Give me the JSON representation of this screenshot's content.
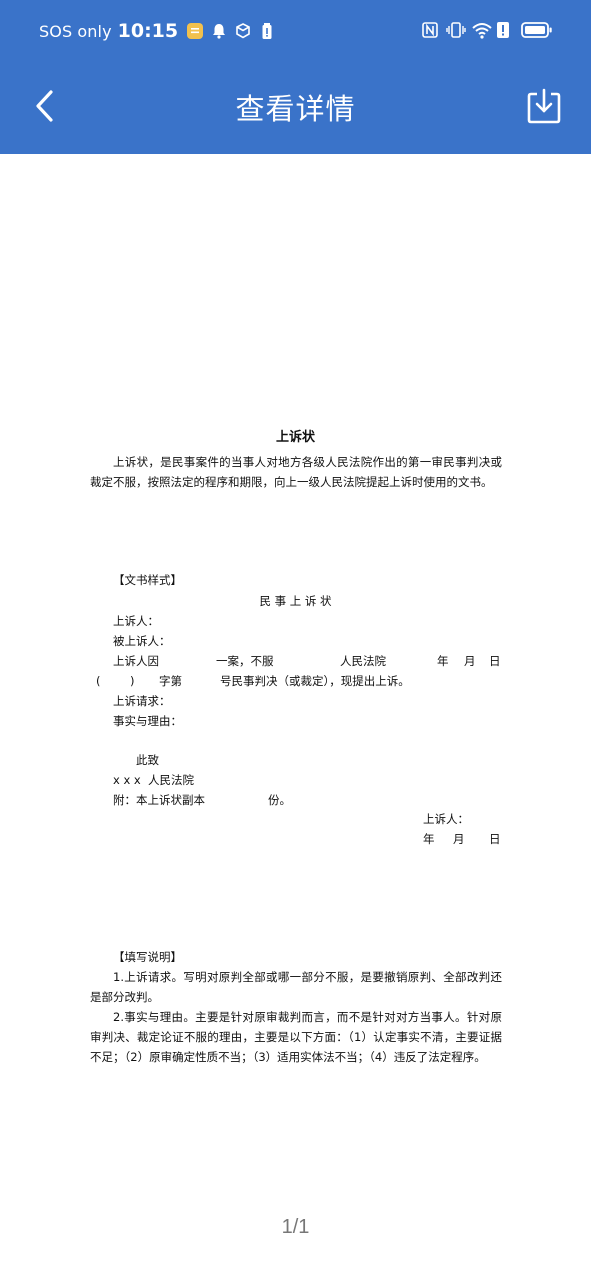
{
  "status_bar": {
    "carrier": "SOS only",
    "time": "10:15"
  },
  "header": {
    "title": "查看详情"
  },
  "document": {
    "title": "上诉状",
    "intro": "上诉状，是民事案件的当事人对地方各级人民法院作出的第一审民事判决或裁定不服，按照法定的程序和期限，向上一级人民法院提起上诉时使用的文书。",
    "sample_heading": "【文书样式】",
    "form_title": "民 事 上 诉 状",
    "appellant": "上诉人：",
    "appellee": "被上诉人：",
    "case_line_1a": "上诉人因",
    "case_line_1b": "一案，不服",
    "case_line_1c": "人民法院",
    "case_line_1d": "年",
    "case_line_1e": "月",
    "case_line_1f": "日",
    "case_line_2a": "(",
    "case_line_2b": ")",
    "case_line_2c": "字第",
    "case_line_2d": "号民事判决（或裁定），现提出上诉。",
    "request": "上诉请求：",
    "facts": "事实与理由：",
    "closing": "此致",
    "court": "x x x  人民法院",
    "attach_a": "附：本上诉状副本",
    "attach_b": "份。",
    "sign": "上诉人：",
    "date_year": "年",
    "date_month": "月",
    "date_day": "日",
    "notes_heading": "【填写说明】",
    "note_1": "1.上诉请求。写明对原判全部或哪一部分不服，是要撤销原判、全部改判还是部分改判。",
    "note_2": "2.事实与理由。主要是针对原审裁判而言，而不是针对对方当事人。针对原审判决、裁定论证不服的理由，主要是以下方面：（1）认定事实不清，主要证据不足；（2）原审确定性质不当；（3）适用实体法不当；（4）违反了法定程序。"
  },
  "pagination": {
    "label": "1/1"
  },
  "colors": {
    "header_bg": "#3a73c9",
    "header_text": "#ffffff",
    "page_bg": "#ffffff"
  },
  "icons": {
    "back": "back-arrow-icon",
    "download": "download-icon"
  }
}
